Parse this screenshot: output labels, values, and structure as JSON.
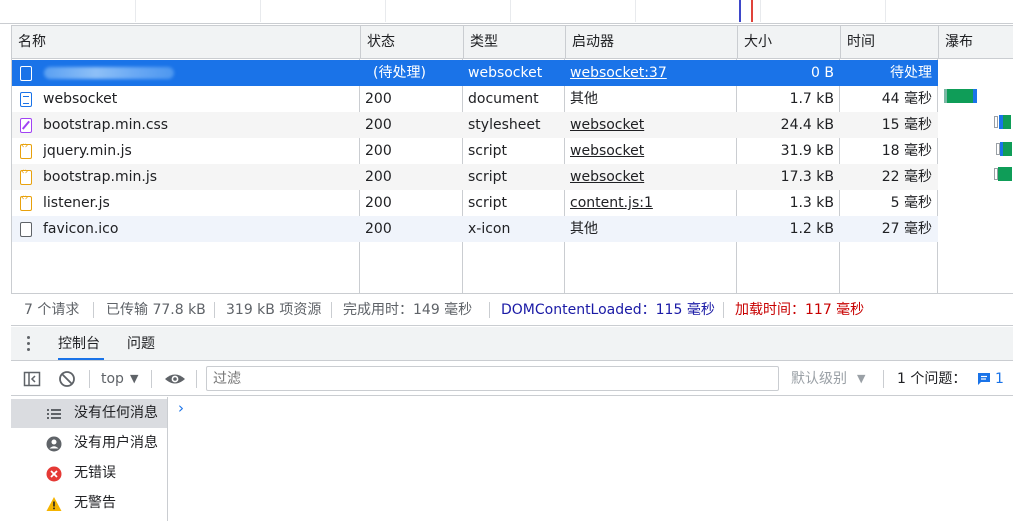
{
  "table": {
    "headers": [
      "名称",
      "状态",
      "类型",
      "启动器",
      "大小",
      "时间",
      "瀑布"
    ],
    "rows": [
      {
        "name": "",
        "status": "(待处理)",
        "type": "websocket",
        "initiator": "websocket:37",
        "initiator_link": true,
        "size": "0 B",
        "time": "待处理",
        "icon": "file-icon",
        "selected": true
      },
      {
        "name": "websocket",
        "status": "200",
        "type": "document",
        "initiator": "其他",
        "initiator_link": false,
        "size": "1.7 kB",
        "time": "44 毫秒",
        "icon": "document-icon"
      },
      {
        "name": "bootstrap.min.css",
        "status": "200",
        "type": "stylesheet",
        "initiator": "websocket",
        "initiator_link": true,
        "size": "24.4 kB",
        "time": "15 毫秒",
        "icon": "stylesheet-icon"
      },
      {
        "name": "jquery.min.js",
        "status": "200",
        "type": "script",
        "initiator": "websocket",
        "initiator_link": true,
        "size": "31.9 kB",
        "time": "18 毫秒",
        "icon": "script-icon"
      },
      {
        "name": "bootstrap.min.js",
        "status": "200",
        "type": "script",
        "initiator": "websocket",
        "initiator_link": true,
        "size": "17.3 kB",
        "time": "22 毫秒",
        "icon": "script-icon"
      },
      {
        "name": "listener.js",
        "status": "200",
        "type": "script",
        "initiator": "content.js:1",
        "initiator_link": true,
        "size": "1.3 kB",
        "time": "5 毫秒",
        "icon": "script-icon"
      },
      {
        "name": "favicon.ico",
        "status": "200",
        "type": "x-icon",
        "initiator": "其他",
        "initiator_link": false,
        "size": "1.2 kB",
        "time": "27 毫秒",
        "icon": "file-icon"
      }
    ]
  },
  "summary": {
    "requests": "7 个请求",
    "transferred": "已传输 77.8 kB",
    "resources": "319 kB 项资源",
    "finish": "完成用时：149 毫秒",
    "dcl": "DOMContentLoaded：115 毫秒",
    "load": "加载时间：117 毫秒"
  },
  "drawer": {
    "tabs": [
      "控制台",
      "问题"
    ],
    "active_tab": "控制台"
  },
  "console_toolbar": {
    "context": "top",
    "filter_placeholder": "过滤",
    "level": "默认级别",
    "issues_label": "1 个问题：",
    "issues_count": "1"
  },
  "sidebar": {
    "items": [
      {
        "label": "没有任何消息",
        "icon": "list-icon",
        "active": true
      },
      {
        "label": "没有用户消息",
        "icon": "user-icon",
        "active": false
      },
      {
        "label": "无错误",
        "icon": "error-icon",
        "active": false
      },
      {
        "label": "无警告",
        "icon": "warning-icon",
        "active": false
      }
    ]
  },
  "colors": {
    "accent": "#1a73e8",
    "dcl": "#1a1aa6",
    "load": "#c80000"
  }
}
